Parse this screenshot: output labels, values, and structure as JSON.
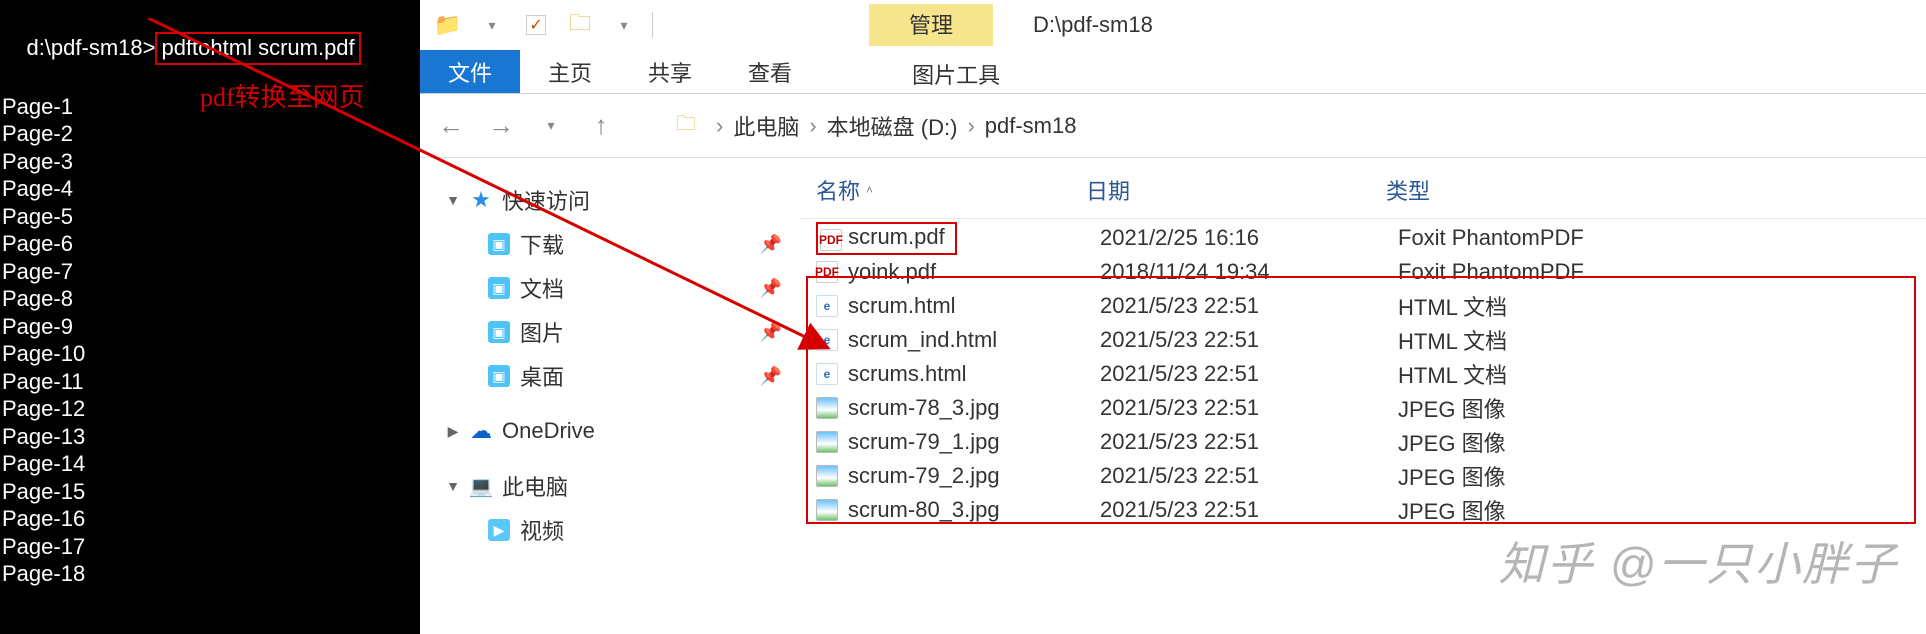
{
  "terminal": {
    "prompt": "d:\\pdf-sm18>",
    "command": "pdftohtml scrum.pdf",
    "pages": [
      "Page-1",
      "Page-2",
      "Page-3",
      "Page-4",
      "Page-5",
      "Page-6",
      "Page-7",
      "Page-8",
      "Page-9",
      "Page-10",
      "Page-11",
      "Page-12",
      "Page-13",
      "Page-14",
      "Page-15",
      "Page-16",
      "Page-17",
      "Page-18"
    ],
    "annotation": "pdf转换至网页"
  },
  "explorer": {
    "title_path": "D:\\pdf-sm18",
    "context_label": "管理",
    "tabs": {
      "file": "文件",
      "home": "主页",
      "share": "共享",
      "view": "查看",
      "context": "图片工具"
    },
    "breadcrumbs": [
      "此电脑",
      "本地磁盘 (D:)",
      "pdf-sm18"
    ],
    "nav_pane": {
      "quick_access": "快速访问",
      "quick_items": [
        {
          "label": "下载"
        },
        {
          "label": "文档"
        },
        {
          "label": "图片"
        },
        {
          "label": "桌面"
        }
      ],
      "onedrive": "OneDrive",
      "this_pc": "此电脑",
      "pc_items": [
        {
          "label": "视频"
        }
      ]
    },
    "columns": {
      "name": "名称",
      "date": "日期",
      "type": "类型"
    },
    "files": [
      {
        "name": "scrum.pdf",
        "date": "2021/2/25 16:16",
        "type": "Foxit PhantomPDF",
        "icon": "pdf",
        "highlight": true
      },
      {
        "name": "yoink.pdf",
        "date": "2018/11/24 19:34",
        "type": "Foxit PhantomPDF",
        "icon": "pdf"
      },
      {
        "name": "scrum.html",
        "date": "2021/5/23 22:51",
        "type": "HTML 文档",
        "icon": "html"
      },
      {
        "name": "scrum_ind.html",
        "date": "2021/5/23 22:51",
        "type": "HTML 文档",
        "icon": "html"
      },
      {
        "name": "scrums.html",
        "date": "2021/5/23 22:51",
        "type": "HTML 文档",
        "icon": "html"
      },
      {
        "name": "scrum-78_3.jpg",
        "date": "2021/5/23 22:51",
        "type": "JPEG 图像",
        "icon": "jpg"
      },
      {
        "name": "scrum-79_1.jpg",
        "date": "2021/5/23 22:51",
        "type": "JPEG 图像",
        "icon": "jpg"
      },
      {
        "name": "scrum-79_2.jpg",
        "date": "2021/5/23 22:51",
        "type": "JPEG 图像",
        "icon": "jpg"
      },
      {
        "name": "scrum-80_3.jpg",
        "date": "2021/5/23 22:51",
        "type": "JPEG 图像",
        "icon": "jpg"
      }
    ]
  },
  "watermark": "知乎 @一只小胖子"
}
